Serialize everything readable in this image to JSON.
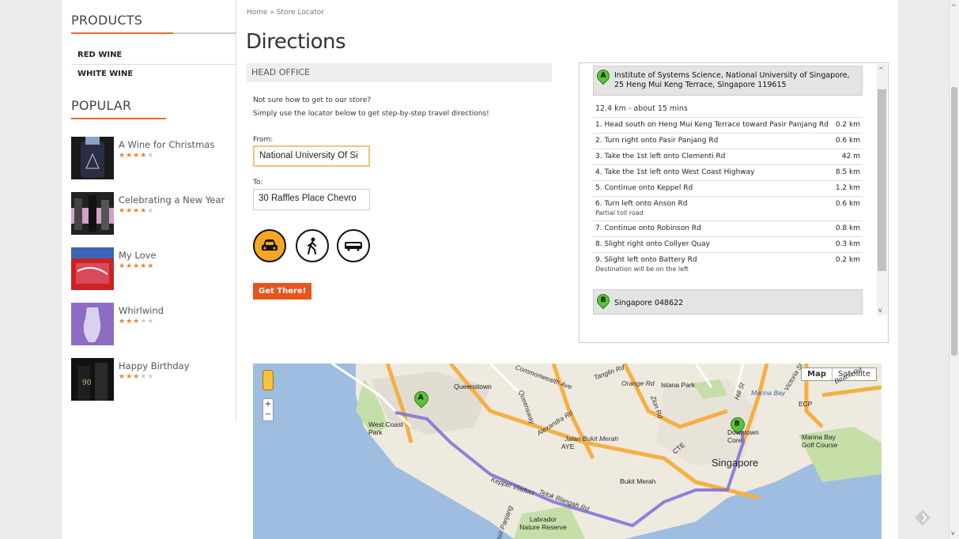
{
  "sidebar": {
    "products_title": "PRODUCTS",
    "categories": [
      "RED WINE",
      "WHITE WINE"
    ],
    "popular_title": "POPULAR",
    "popular": [
      {
        "name": "A Wine for Christmas",
        "rating": 4
      },
      {
        "name": "Celebrating a New Year",
        "rating": 4
      },
      {
        "name": "My Love",
        "rating": 5
      },
      {
        "name": "Whirlwind",
        "rating": 3
      },
      {
        "name": "Happy Birthday",
        "rating": 3
      }
    ]
  },
  "breadcrumb": "Home » Store Locator",
  "page_title": "Directions",
  "office_title": "HEAD OFFICE",
  "intro_line1": "Not sure how to get to our store?",
  "intro_line2": "Simply use the locator below to get step-by-step travel directions!",
  "from_label": "From:",
  "from_value": "National University Of Si",
  "to_label": "To:",
  "to_value": "30 Raffles Place Chevro",
  "travel_modes": [
    "car-icon",
    "walking-icon",
    "bus-icon"
  ],
  "submit_label": "Get There!",
  "directions": {
    "origin_marker": "A",
    "origin": "Institute of Systems Science, National University of Singapore, 25 Heng Mui Keng Terrace, Singapore 119615",
    "summary": "12.4 km - about 15 mins",
    "steps": [
      {
        "text": "1.  Head south on Heng Mui Keng Terrace toward Pasir Panjang Rd",
        "note": "",
        "distance": "0.2 km"
      },
      {
        "text": "2.  Turn right onto Pasir Panjang Rd",
        "note": "",
        "distance": "0.6 km"
      },
      {
        "text": "3.  Take the 1st left onto Clementi Rd",
        "note": "",
        "distance": "42 m"
      },
      {
        "text": "4.  Take the 1st left onto West Coast Highway",
        "note": "",
        "distance": "8.5 km"
      },
      {
        "text": "5.  Continue onto Keppel Rd",
        "note": "",
        "distance": "1.2 km"
      },
      {
        "text": "6.  Turn left onto Anson Rd",
        "note": "Partial toll road",
        "distance": "0.6 km"
      },
      {
        "text": "7.  Continue onto Robinson Rd",
        "note": "",
        "distance": "0.8 km"
      },
      {
        "text": "8.  Slight right onto Collyer Quay",
        "note": "",
        "distance": "0.3 km"
      },
      {
        "text": "9.  Slight left onto Battery Rd",
        "note": "Destination will be on the left",
        "distance": "0.2 km"
      }
    ],
    "destination_marker": "B",
    "destination": "Singapore 048622"
  },
  "map": {
    "type_map": "Map",
    "type_satellite": "Satellite",
    "zoom_in": "+",
    "zoom_out": "−",
    "labels": [
      "Queenstown",
      "West Coast Park",
      "Jalan Bukit Merah",
      "AYE",
      "Singapore",
      "Bukit Merah",
      "Keppel Viaduct",
      "Telok Blangah Rd",
      "Labrador Nature Reserve",
      "Orange Rd",
      "Istana Park",
      "Marina Bay",
      "Marina Bay Golf Course",
      "Downtown Core",
      "ECP",
      "CTE",
      "Alexandra Rd",
      "Beach Rd",
      "Hill St",
      "Victoria St",
      "Commonwealth Ave",
      "Queensway",
      "Zion Rd",
      "Tanglin Rd",
      "Pasir Panjang"
    ]
  },
  "colors": {
    "accent": "#e8531e",
    "rule": "#e86a2a",
    "stars": "#e8832c",
    "route": "#7b6fd6",
    "active_mode": "#f5a623"
  }
}
